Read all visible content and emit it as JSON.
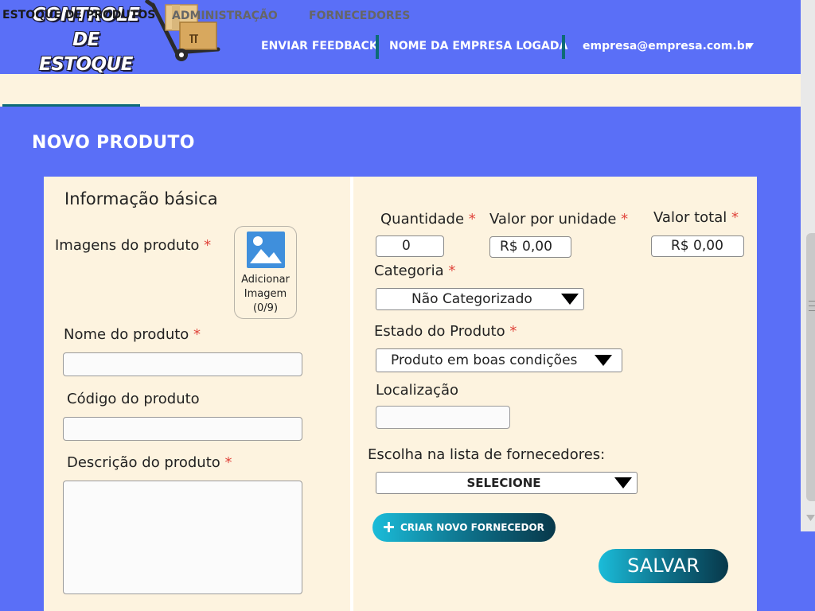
{
  "header": {
    "logo_line1": "CONTROLE DE",
    "logo_line2": "ESTOQUE",
    "nav": {
      "feedback": "ENVIAR FEEDBACK",
      "company": "NOME DA EMPRESA LOGADA",
      "user_email": "empresa@empresa.com.br"
    }
  },
  "tabs": [
    {
      "label": "ESTOQUE DE PRODUTOS",
      "active": true
    },
    {
      "label": "ADMINISTRAÇÃO",
      "active": false
    },
    {
      "label": "FORNECEDORES",
      "active": false
    }
  ],
  "page_title": "NOVO PRODUTO",
  "form": {
    "section_title": "Informação básica",
    "images": {
      "label": "Imagens do produto",
      "required": true,
      "add_line1": "Adicionar",
      "add_line2": "Imagem",
      "count": "(0/9)"
    },
    "nome": {
      "label": "Nome do produto",
      "required": true,
      "value": ""
    },
    "codigo": {
      "label": "Código do produto",
      "required": false,
      "value": ""
    },
    "descricao": {
      "label": "Descrição do produto",
      "required": true,
      "value": ""
    },
    "quantidade": {
      "label": "Quantidade",
      "required": true,
      "value": "0"
    },
    "valor_unidade": {
      "label": "Valor por unidade",
      "required": true,
      "value": "R$ 0,00"
    },
    "valor_total": {
      "label": "Valor total",
      "required": true,
      "value": "R$ 0,00"
    },
    "categoria": {
      "label": "Categoria",
      "required": true,
      "selected": "Não Categorizado"
    },
    "estado": {
      "label": "Estado  do Produto",
      "required": true,
      "selected": "Produto em boas  condições"
    },
    "localizacao": {
      "label": "Localização",
      "required": false,
      "value": ""
    },
    "fornecedor": {
      "label": "Escolha na lista de fornecedores:",
      "selected": "SELECIONE"
    },
    "criar_fornecedor_label": "CRIAR NOVO FORNECEDOR",
    "salvar_label": "SALVAR"
  },
  "colors": {
    "page_bg": "#5a6ff7",
    "panel_bg": "#fdf3df",
    "accent": "#0d6b76",
    "required_mark": "#e0453c",
    "button_gradient_start": "#1bbcd9",
    "button_gradient_end": "#08384a"
  },
  "icons": [
    "hand-truck-boxes-icon",
    "image-placeholder-icon",
    "dropdown-triangle-icon",
    "plus-icon",
    "caret-down-icon"
  ]
}
